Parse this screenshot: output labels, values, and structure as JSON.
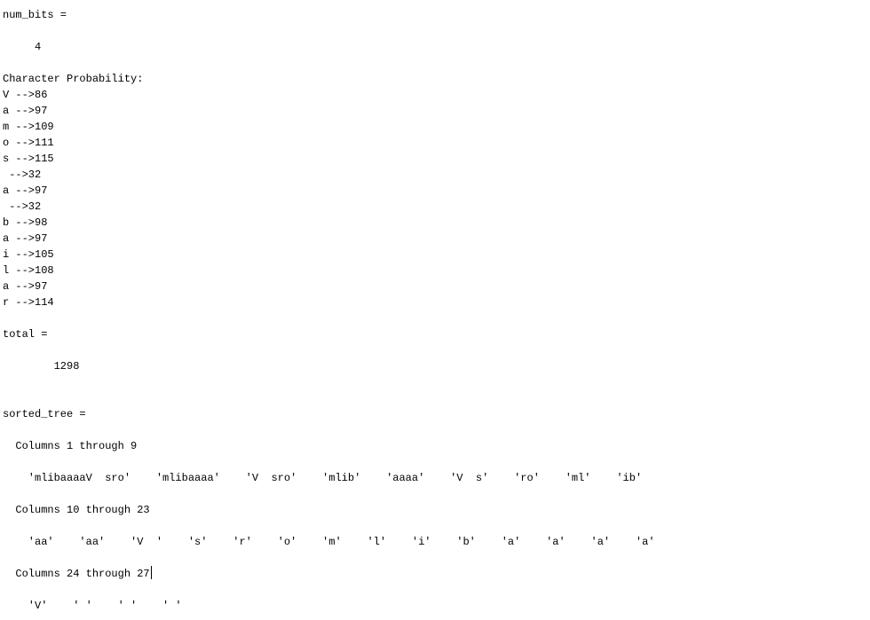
{
  "console": {
    "num_bits_label": "num_bits =",
    "num_bits_value": "     4",
    "char_prob_header": "Character Probability:",
    "char_prob": [
      "V -->86",
      "a -->97",
      "m -->109",
      "o -->111",
      "s -->115",
      " -->32",
      "a -->97",
      " -->32",
      "b -->98",
      "a -->97",
      "i -->105",
      "l -->108",
      "a -->97",
      "r -->114"
    ],
    "total_label": "total =",
    "total_value": "        1298",
    "sorted_tree_label": "sorted_tree =",
    "columns_1_9_label": "  Columns 1 through 9",
    "columns_1_9_values": "    'mlibaaaaV  sro'    'mlibaaaa'    'V  sro'    'mlib'    'aaaa'    'V  s'    'ro'    'ml'    'ib'",
    "columns_10_23_label": "  Columns 10 through 23",
    "columns_10_23_values": "    'aa'    'aa'    'V  '    's'    'r'    'o'    'm'    'l'    'i'    'b'    'a'    'a'    'a'    'a'",
    "columns_24_27_label": "  Columns 24 through 27",
    "columns_24_27_values": "    'V'    ' '    ' '    ' '"
  }
}
